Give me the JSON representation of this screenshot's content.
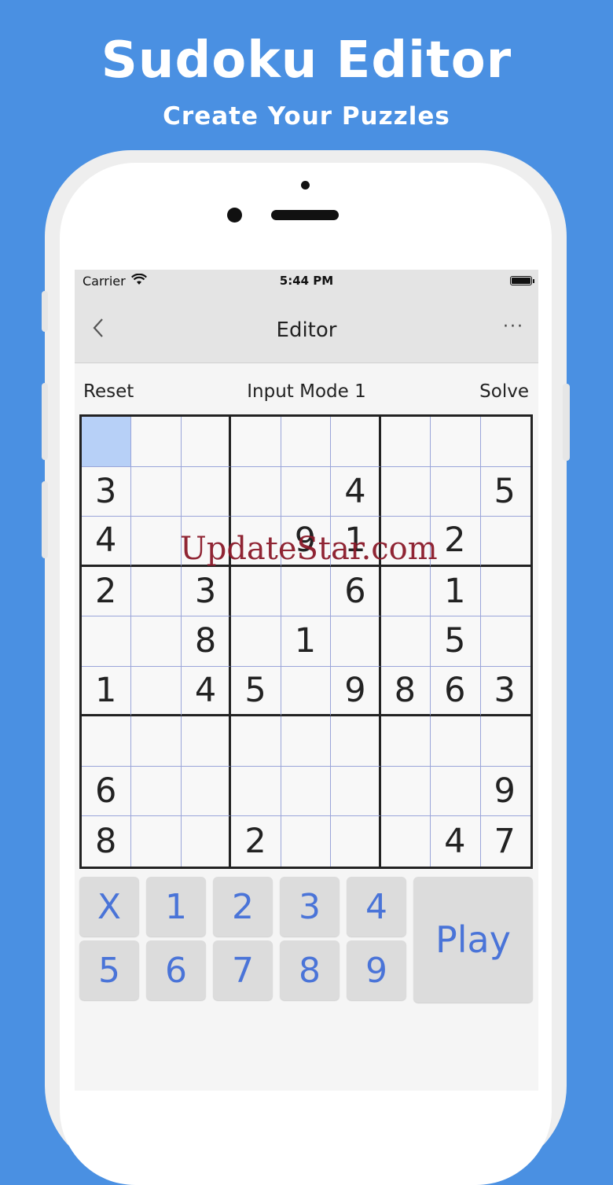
{
  "colors": {
    "background": "#4a90e2",
    "accent": "#4a74d8",
    "selected_cell": "#b7d0f7"
  },
  "hero": {
    "title": "Sudoku Editor",
    "subtitle": "Create Your Puzzles"
  },
  "status_bar": {
    "carrier": "Carrier",
    "time": "5:44 PM",
    "wifi_icon": "wifi-icon",
    "battery_icon": "battery-icon"
  },
  "nav": {
    "back_icon": "chevron-left-icon",
    "title": "Editor",
    "more_label": "···"
  },
  "toolbar": {
    "reset_label": "Reset",
    "mode_label": "Input Mode 1",
    "solve_label": "Solve"
  },
  "board": {
    "selected_cell": [
      0,
      0
    ],
    "rows": [
      [
        "",
        "",
        "",
        "",
        "",
        "",
        "",
        "",
        ""
      ],
      [
        "3",
        "",
        "",
        "",
        "",
        "4",
        "",
        "",
        "5"
      ],
      [
        "4",
        "",
        "",
        "",
        "9",
        "1",
        "",
        "2",
        ""
      ],
      [
        "2",
        "",
        "3",
        "",
        "",
        "6",
        "",
        "1",
        ""
      ],
      [
        "",
        "",
        "8",
        "",
        "1",
        "",
        "",
        "5",
        ""
      ],
      [
        "1",
        "",
        "4",
        "5",
        "",
        "9",
        "8",
        "6",
        "3"
      ],
      [
        "",
        "",
        "",
        "",
        "",
        "",
        "",
        "",
        ""
      ],
      [
        "6",
        "",
        "",
        "",
        "",
        "",
        "",
        "",
        "9"
      ],
      [
        "8",
        "",
        "",
        "2",
        "",
        "",
        "",
        "4",
        "7"
      ]
    ]
  },
  "watermark": "UpdateStar.com",
  "keypad": {
    "keys": [
      "X",
      "1",
      "2",
      "3",
      "4",
      "5",
      "6",
      "7",
      "8",
      "9"
    ],
    "play_label": "Play"
  }
}
